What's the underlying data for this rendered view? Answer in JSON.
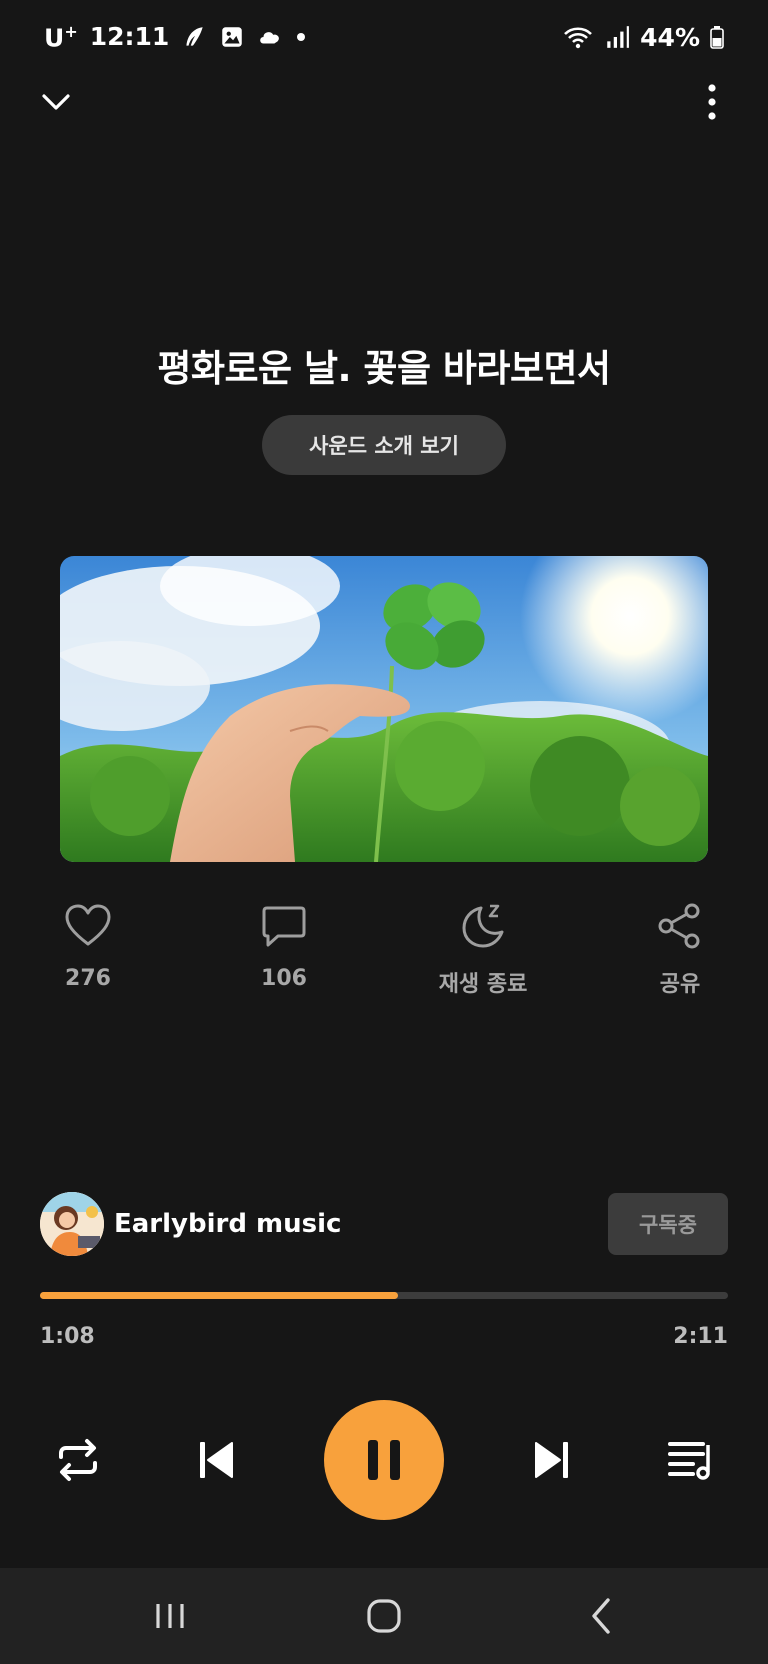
{
  "status_bar": {
    "carrier": "U",
    "carrier_sup": "+",
    "time": "12:11",
    "battery": "44%",
    "icons": [
      "feather-icon",
      "image-icon",
      "cloud-icon",
      "dot-icon",
      "wifi-icon",
      "signal-icon",
      "battery-icon"
    ]
  },
  "player": {
    "title": "평화로운 날. 꽃을 바라보면서",
    "intro_button": "사운드 소개 보기",
    "cover_icon": "four-leaf-clover-photo"
  },
  "actions": [
    {
      "icon": "heart-icon",
      "label": "276"
    },
    {
      "icon": "comment-icon",
      "label": "106"
    },
    {
      "icon": "sleep-timer-icon",
      "label": "재생 종료"
    },
    {
      "icon": "share-icon",
      "label": "공유"
    }
  ],
  "channel": {
    "name": "Earlybird music",
    "subscribe_label": "구독중"
  },
  "progress": {
    "current": "1:08",
    "total": "2:11",
    "fraction": 0.52
  },
  "controls": [
    "repeat-icon",
    "previous-icon",
    "pause-icon",
    "next-icon",
    "playlist-icon"
  ],
  "nav": [
    "recent-apps-icon",
    "home-icon",
    "back-icon"
  ],
  "colors": {
    "background": "#161616",
    "accent": "#f8a13c",
    "button": "#3a3a3a",
    "muted_text": "#a8a8a8"
  }
}
